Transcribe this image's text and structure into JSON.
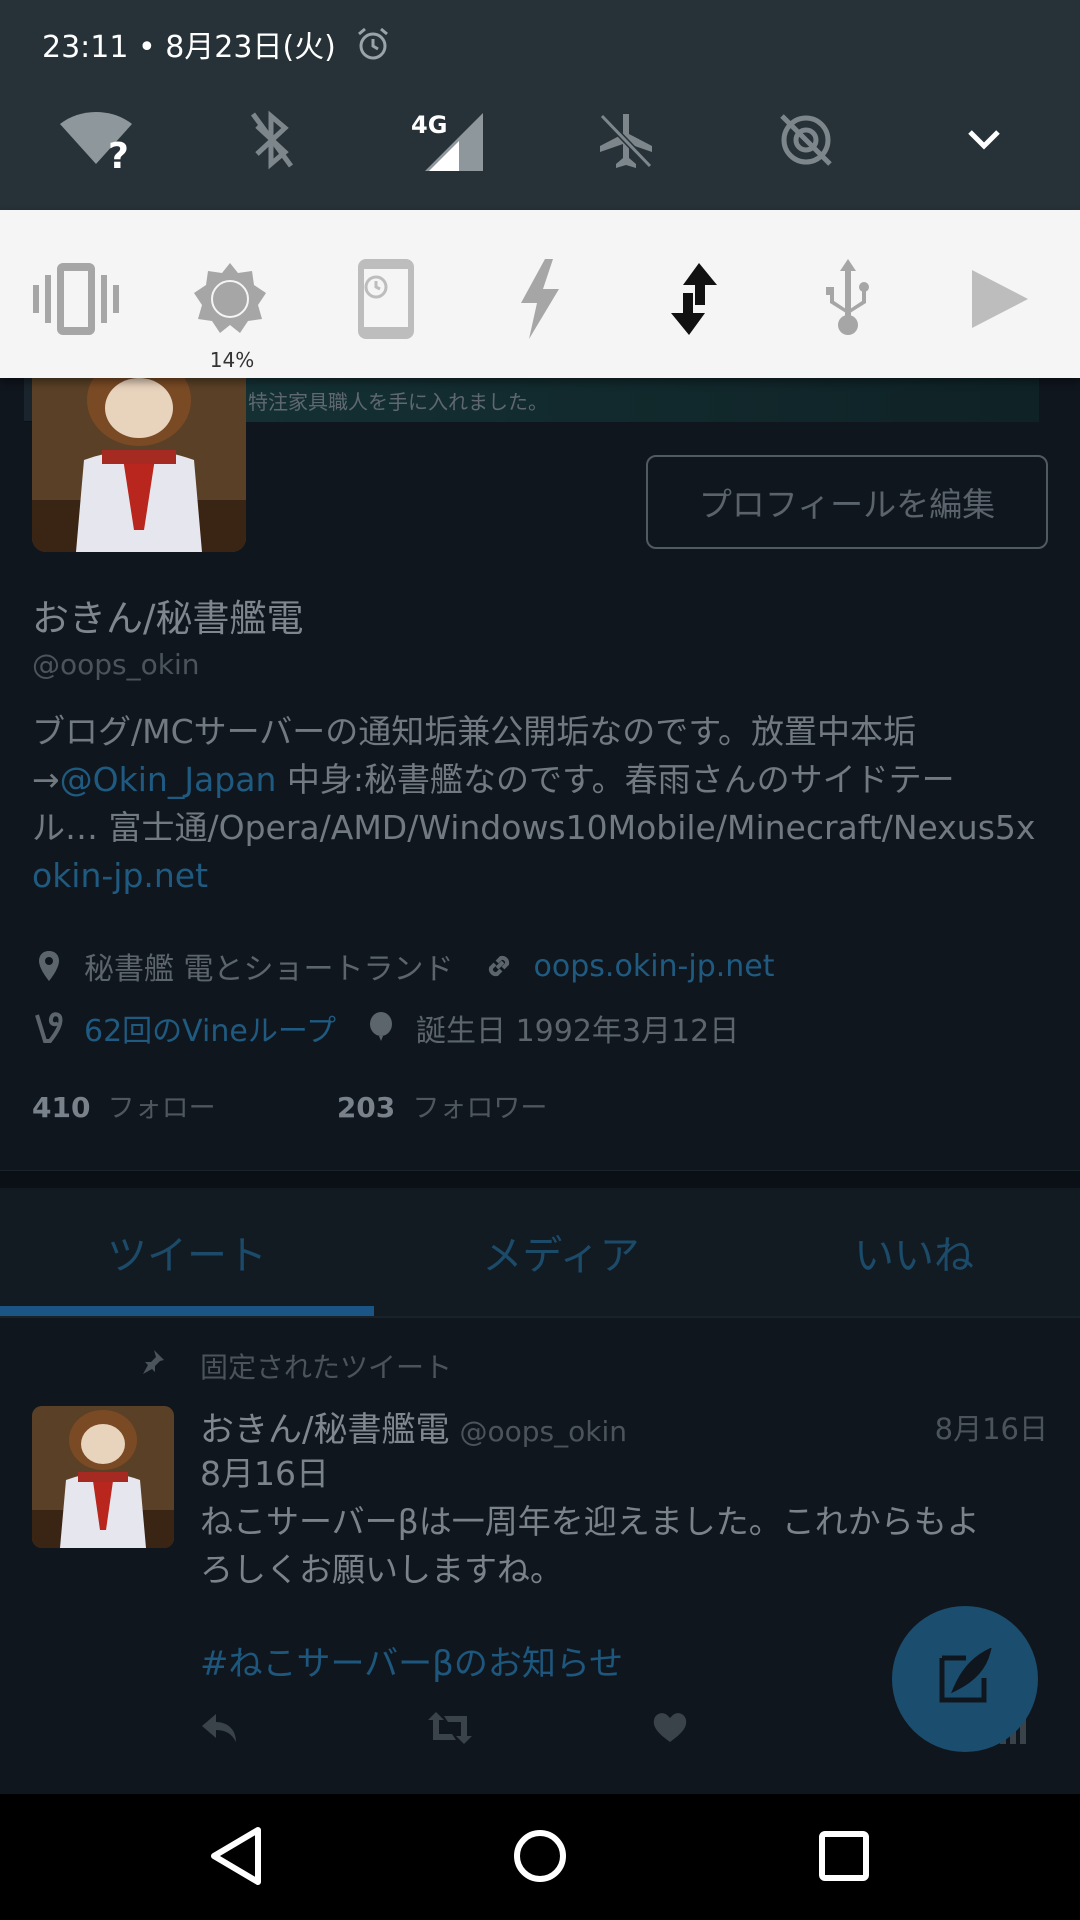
{
  "status_bar": {
    "time_date": "23:11 • 8月23日(火)",
    "network_label": "4G"
  },
  "quick_settings": {
    "brightness_value": "14%"
  },
  "profile": {
    "banner_text": "特注家具職人を手に入れました。",
    "edit_button": "プロフィールを編集",
    "display_name": "おきん/秘書艦電",
    "handle": "@oops_okin",
    "bio_line1": "ブログ/MCサーバーの通知垢兼公開垢なのです。放置中本垢",
    "bio_arrow": "→",
    "bio_mention": "@Okin_Japan",
    "bio_line2_rest": " 中身:秘書艦なのです。春雨さんのサイドテー",
    "bio_line3": "ル… 富士通/Opera/AMD/Windows10Mobile/Minecraft/Nexus5x",
    "bio_link": "okin-jp.net",
    "location": "秘書艦 電とショートランド",
    "website": "oops.okin-jp.net",
    "vine_loops": "62回のVineループ",
    "birthday": "誕生日 1992年3月12日",
    "following_count": "410",
    "following_label": "フォロー",
    "followers_count": "203",
    "followers_label": "フォロワー"
  },
  "tabs": [
    "ツイート",
    "メディア",
    "いいね"
  ],
  "tweet": {
    "pinned_label": "固定されたツイート",
    "author_name": "おきん/秘書艦電",
    "author_handle": "@oops_okin",
    "date": "8月16日",
    "body_line1": "8月16日",
    "body_line2": "ねこサーバーβは一周年を迎えました。これからもよ",
    "body_line3": "ろしくお願いしますね。",
    "hashtag": "#ねこサーバーβのお知らせ"
  }
}
